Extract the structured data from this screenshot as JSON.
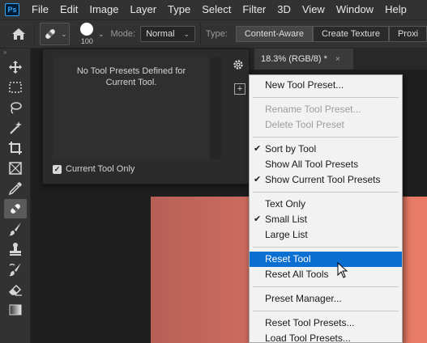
{
  "menubar": {
    "logo": "Ps",
    "items": [
      "File",
      "Edit",
      "Image",
      "Layer",
      "Type",
      "Select",
      "Filter",
      "3D",
      "View",
      "Window",
      "Help"
    ]
  },
  "options": {
    "brush_size": "100",
    "mode_label": "Mode:",
    "mode_value": "Normal",
    "type_label": "Type:",
    "type_options": [
      "Content-Aware",
      "Create Texture",
      "Proxi"
    ],
    "type_selected": "Content-Aware"
  },
  "preset_panel": {
    "message": "No Tool Presets Defined for Current Tool.",
    "current_only_label": "Current Tool Only",
    "current_only_checked": true
  },
  "document": {
    "tab_label": "18.3% (RGB/8) *",
    "close_glyph": "×"
  },
  "flyout_menu": {
    "items": [
      {
        "label": "New Tool Preset...",
        "disabled": false,
        "checked": false,
        "highlighted": false
      },
      {
        "label": "Rename Tool Preset...",
        "disabled": true,
        "checked": false,
        "highlighted": false
      },
      {
        "label": "Delete Tool Preset",
        "disabled": true,
        "checked": false,
        "highlighted": false
      },
      {
        "label": "Sort by Tool",
        "disabled": false,
        "checked": true,
        "highlighted": false
      },
      {
        "label": "Show All Tool Presets",
        "disabled": false,
        "checked": false,
        "highlighted": false
      },
      {
        "label": "Show Current Tool Presets",
        "disabled": false,
        "checked": true,
        "highlighted": false
      },
      {
        "label": "Text Only",
        "disabled": false,
        "checked": false,
        "highlighted": false
      },
      {
        "label": "Small List",
        "disabled": false,
        "checked": true,
        "highlighted": false
      },
      {
        "label": "Large List",
        "disabled": false,
        "checked": false,
        "highlighted": false
      },
      {
        "label": "Reset Tool",
        "disabled": false,
        "checked": false,
        "highlighted": true
      },
      {
        "label": "Reset All Tools",
        "disabled": false,
        "checked": false,
        "highlighted": false
      },
      {
        "label": "Preset Manager...",
        "disabled": false,
        "checked": false,
        "highlighted": false
      },
      {
        "label": "Reset Tool Presets...",
        "disabled": false,
        "checked": false,
        "highlighted": false
      },
      {
        "label": "Load Tool Presets...",
        "disabled": false,
        "checked": false,
        "highlighted": false
      }
    ]
  },
  "toolbar": {
    "tools": [
      "move-icon",
      "marquee-icon",
      "lasso-icon",
      "magic-wand-icon",
      "crop-icon",
      "frame-icon",
      "eyedropper-icon",
      "healing-brush-icon",
      "brush-icon",
      "clone-stamp-icon",
      "history-brush-icon",
      "eraser-icon",
      "gradient-icon"
    ],
    "active": "healing-brush-icon"
  },
  "colors": {
    "highlight": "#0b6fd1",
    "image_left": "#b76058",
    "image_right": "#ea7c67"
  }
}
